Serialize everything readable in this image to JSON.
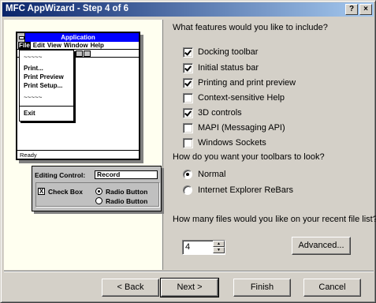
{
  "window": {
    "title": "MFC AppWizard - Step 4 of 6",
    "help_label": "?",
    "close_label": "×"
  },
  "preview": {
    "app_title": "Application",
    "menu": [
      "File",
      "Edit",
      "View",
      "Window",
      "Help"
    ],
    "file_menu": [
      "~~~~~",
      "Print...",
      "Print Preview",
      "Print Setup...",
      "~~~~~",
      "Exit"
    ],
    "status": "Ready",
    "editing_control_label": "Editing Control:",
    "editing_control_value": "Record",
    "check_box_label": "Check Box",
    "check_box_mark": "X",
    "radio1_label": "Radio Button",
    "radio2_label": "Radio Button"
  },
  "features": {
    "question": "What features would you like to include?",
    "items": [
      {
        "label": "Docking toolbar",
        "checked": true
      },
      {
        "label": "Initial status bar",
        "checked": true
      },
      {
        "label": "Printing and print preview",
        "checked": true
      },
      {
        "label": "Context-sensitive Help",
        "checked": false
      },
      {
        "label": "3D controls",
        "checked": true
      },
      {
        "label": "MAPI (Messaging API)",
        "checked": false
      },
      {
        "label": "Windows Sockets",
        "checked": false
      }
    ]
  },
  "toolbars": {
    "question": "How do you want your toolbars to look?",
    "options": [
      {
        "label": "Normal",
        "selected": true
      },
      {
        "label": "Internet Explorer ReBars",
        "selected": false
      }
    ]
  },
  "recent": {
    "question": "How many files would you like on your recent file list?",
    "value": "4"
  },
  "buttons": {
    "advanced": "Advanced...",
    "back": "< Back",
    "next": "Next >",
    "finish": "Finish",
    "cancel": "Cancel"
  }
}
